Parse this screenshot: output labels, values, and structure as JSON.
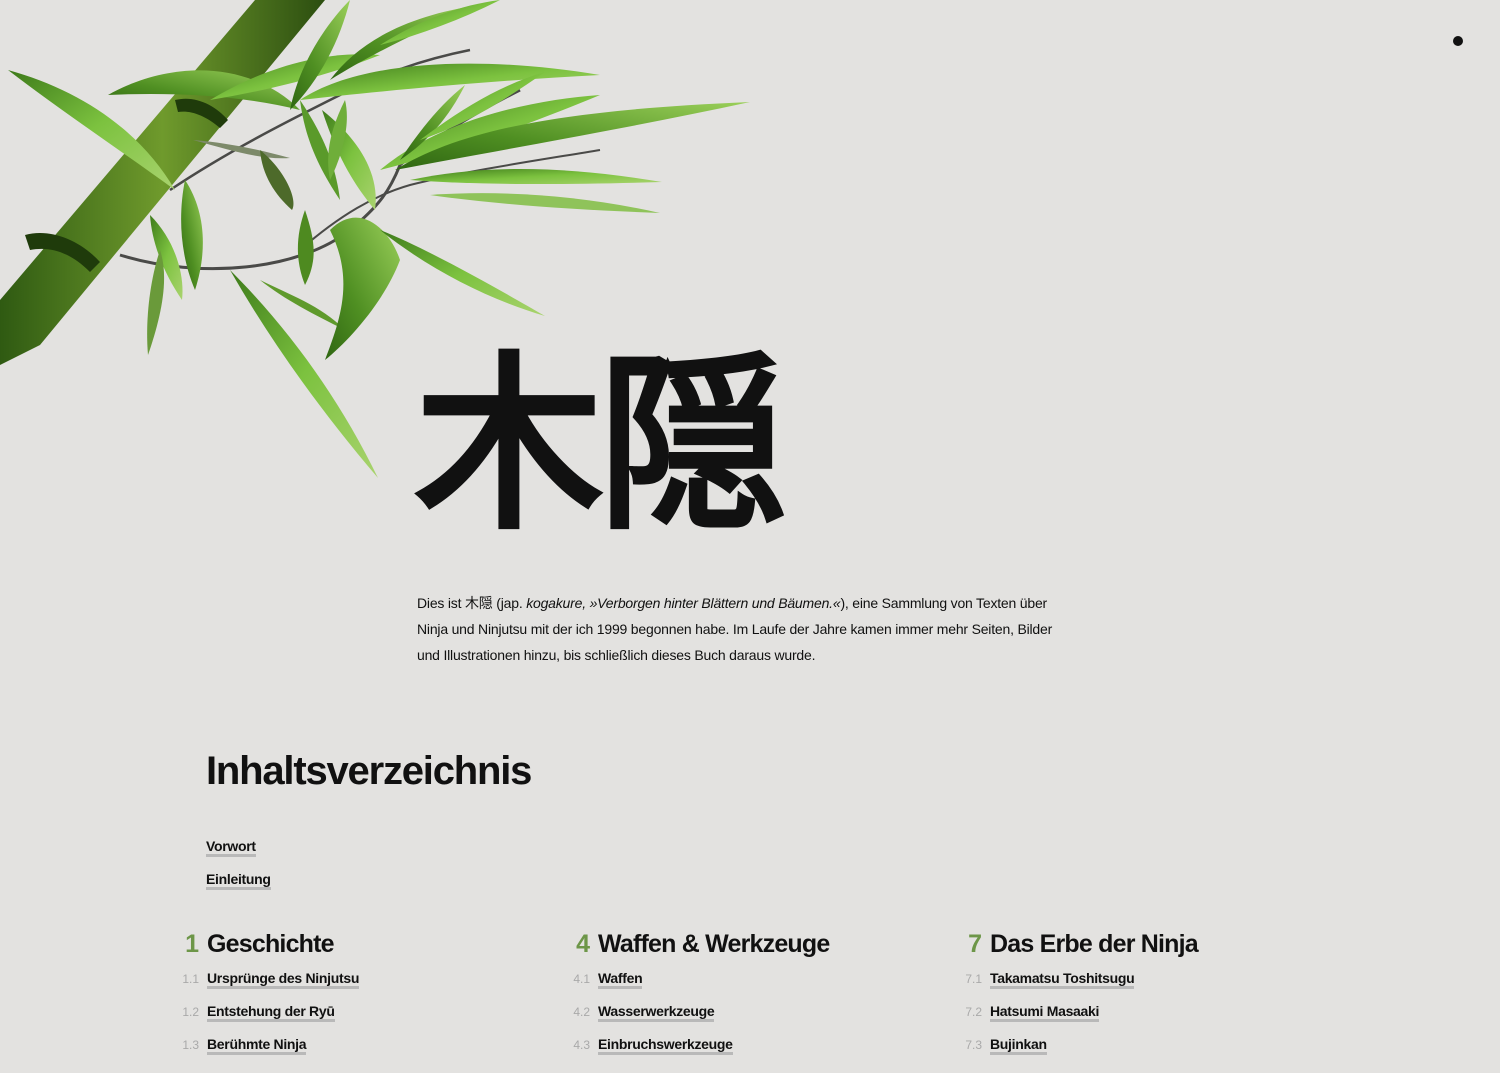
{
  "header": {
    "kanji": "木隠",
    "menu_icon": "menu-dot-icon"
  },
  "intro": {
    "part1": "Dies ist 木隠 (jap. ",
    "part2_italic": "kogakure, »Verborgen hinter Blättern und Bäumen.«",
    "part3": "), eine Sammlung von Texten über Ninja und Ninjutsu mit der ich 1999 begonnen habe. Im Laufe der Jahre kamen immer mehr Seiten, Bilder und Illustrationen hinzu, bis schließlich dieses Buch daraus wurde."
  },
  "toc": {
    "title": "Inhaltsverzeichnis",
    "front": [
      "Vorwort",
      "Einleitung"
    ],
    "chapters": [
      {
        "number": "1",
        "title": "Geschichte",
        "items": [
          {
            "number": "1.1",
            "label": "Ursprünge des Ninjutsu"
          },
          {
            "number": "1.2",
            "label": "Entstehung der Ryū"
          },
          {
            "number": "1.3",
            "label": "Berühmte Ninja"
          }
        ]
      },
      {
        "number": "4",
        "title": "Waffen & Werkzeuge",
        "items": [
          {
            "number": "4.1",
            "label": "Waffen"
          },
          {
            "number": "4.2",
            "label": "Wasserwerkzeuge"
          },
          {
            "number": "4.3",
            "label": "Einbruchswerkzeuge"
          }
        ]
      },
      {
        "number": "7",
        "title": "Das Erbe der Ninja",
        "items": [
          {
            "number": "7.1",
            "label": "Takamatsu Toshitsugu"
          },
          {
            "number": "7.2",
            "label": "Hatsumi Masaaki"
          },
          {
            "number": "7.3",
            "label": "Bujinkan"
          }
        ]
      }
    ]
  },
  "colors": {
    "background": "#e3e2e0",
    "accent_green": "#6d9648",
    "text": "#111111"
  }
}
